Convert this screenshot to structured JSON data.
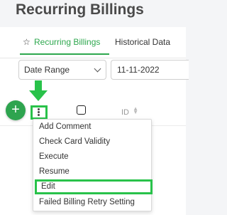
{
  "page": {
    "title": "Recurring Billings"
  },
  "tabs": [
    {
      "label": "Recurring Billings",
      "active": true,
      "icon": "star-outline-icon"
    },
    {
      "label": "Historical Data",
      "active": false
    }
  ],
  "filters": {
    "date_range_label": "Date Range",
    "date_value": "11-11-2022"
  },
  "table": {
    "columns": [
      "ID"
    ]
  },
  "fab": {
    "symbol": "+"
  },
  "context_menu": {
    "items": [
      "Add Comment",
      "Check Card Validity",
      "Execute",
      "Resume",
      "Edit",
      "Failed Billing Retry Setting"
    ],
    "highlighted_index": 4
  },
  "colors": {
    "accent": "#2fa84f",
    "highlight": "#29c24a",
    "title": "#4a4a4a"
  }
}
